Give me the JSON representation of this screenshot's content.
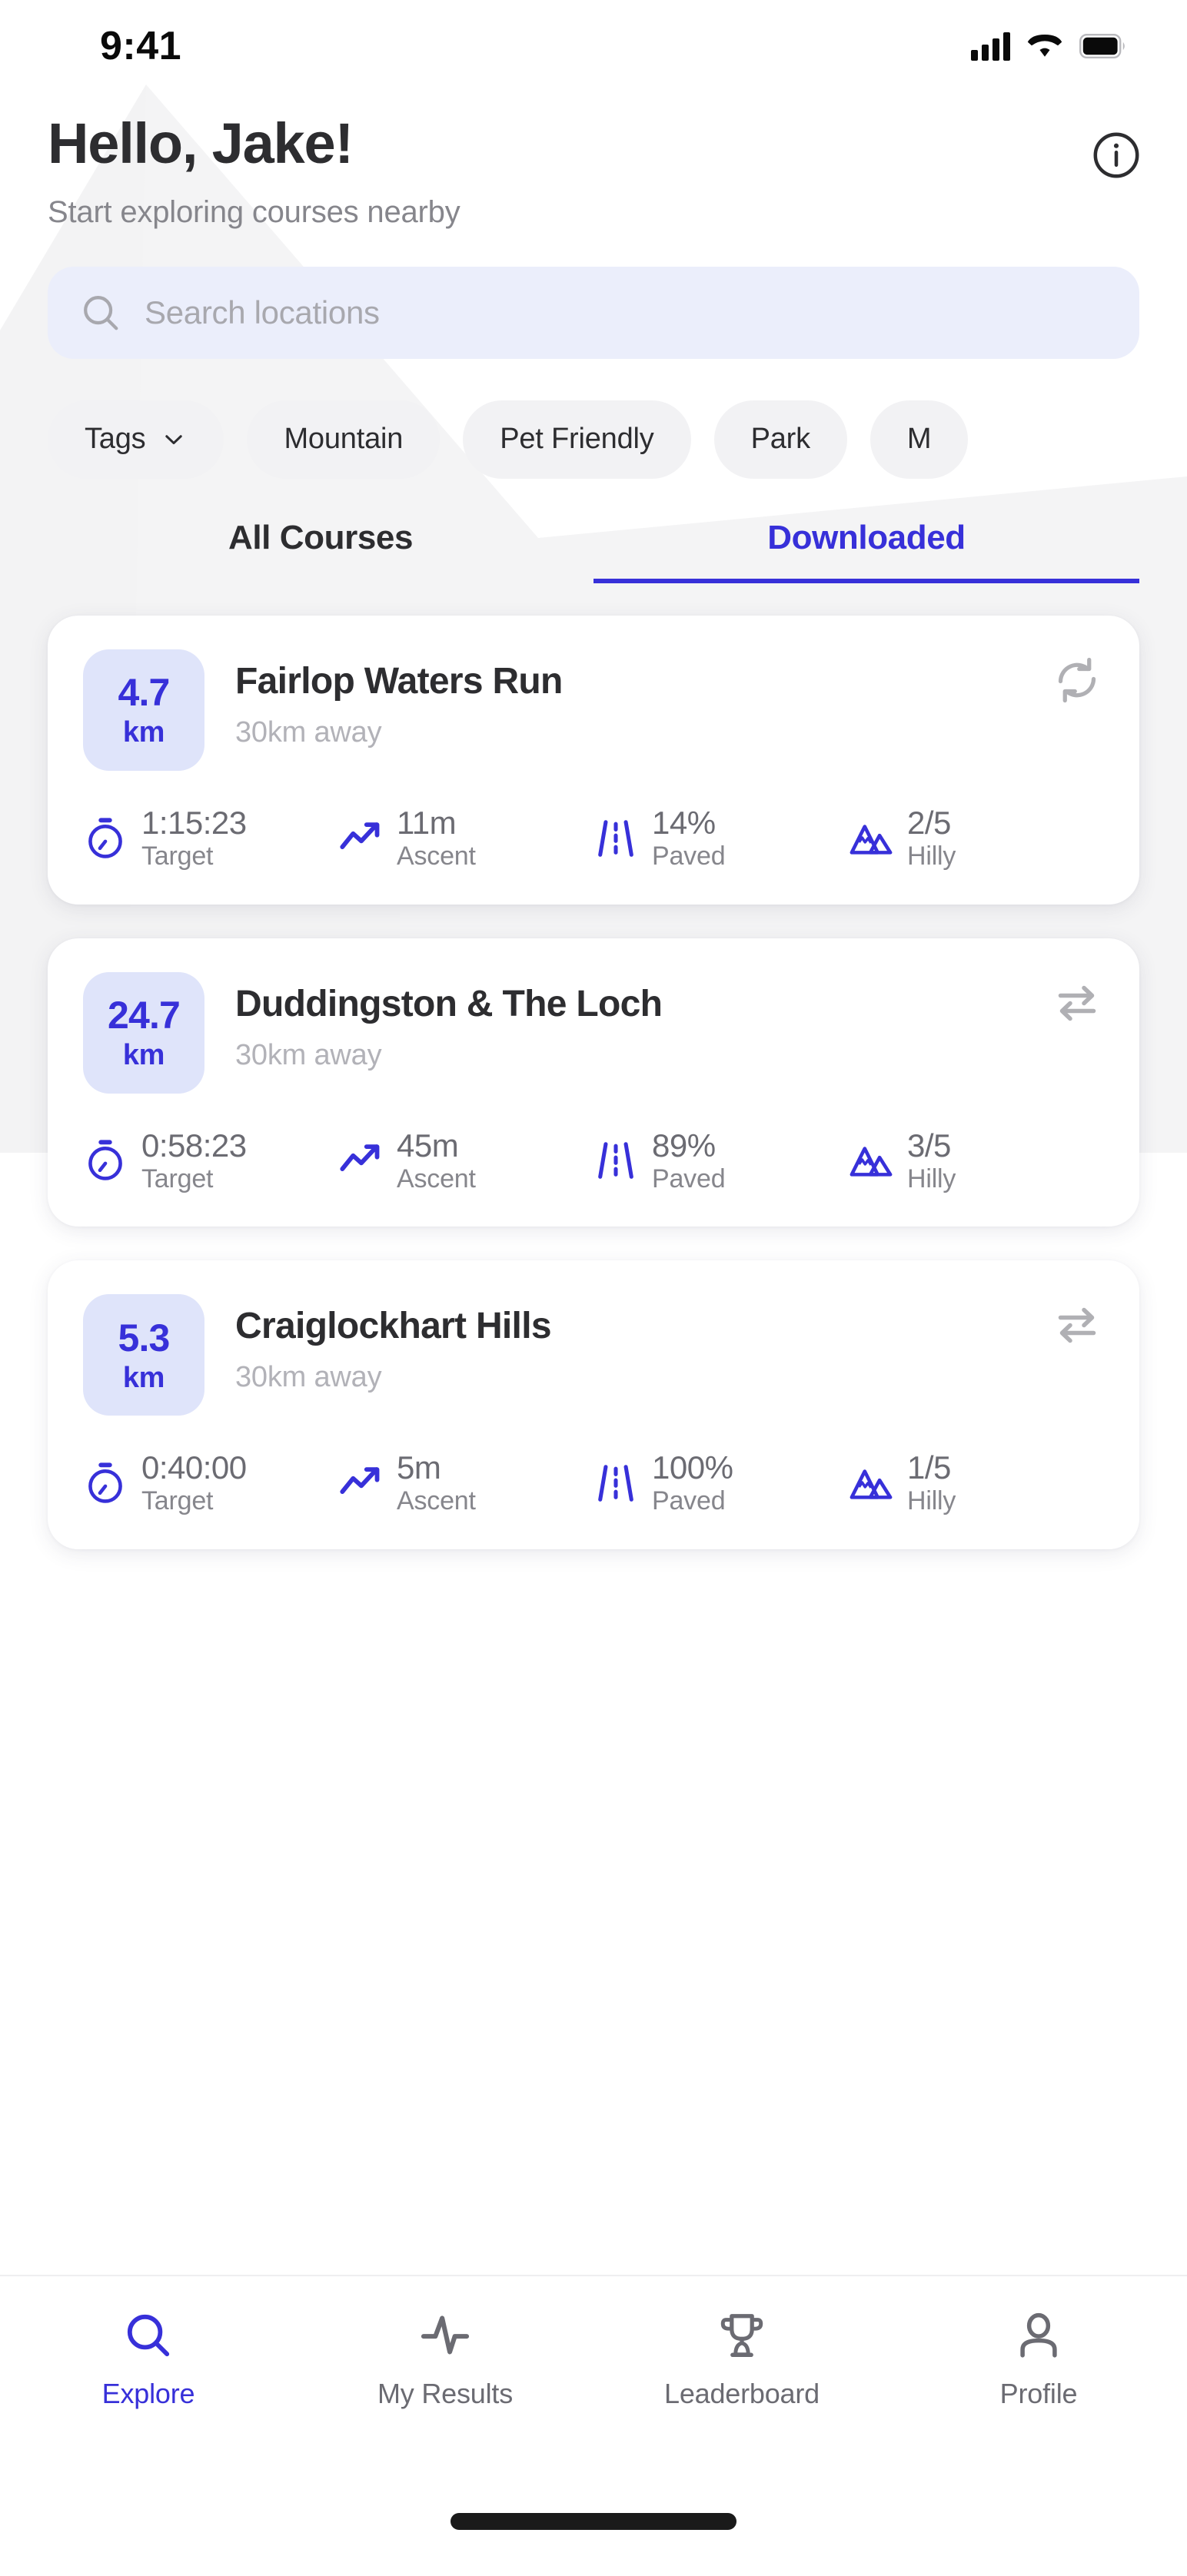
{
  "status_bar": {
    "time": "9:41",
    "cellular_icon": "signal-bars-icon",
    "wifi_icon": "wifi-icon",
    "battery_icon": "battery-icon"
  },
  "header": {
    "greeting": "Hello, Jake!",
    "subtitle": "Start exploring courses nearby",
    "info_icon": "info-circle-icon"
  },
  "search": {
    "placeholder": "Search locations",
    "icon": "search-icon",
    "value": ""
  },
  "filters": {
    "chips": [
      {
        "label": "Tags",
        "has_chevron": true
      },
      {
        "label": "Mountain",
        "has_chevron": false
      },
      {
        "label": "Pet Friendly",
        "has_chevron": false
      },
      {
        "label": "Park",
        "has_chevron": false
      },
      {
        "label": "M",
        "has_chevron": false
      }
    ]
  },
  "tabs": [
    {
      "label": "All Courses",
      "active": false
    },
    {
      "label": "Downloaded",
      "active": true
    }
  ],
  "courses": [
    {
      "distance_value": "4.7",
      "distance_unit": "km",
      "title": "Fairlop Waters Run",
      "subtitle": "30km away",
      "action_icon": "refresh-sync-icon",
      "stats": [
        {
          "icon": "stopwatch-icon",
          "value": "1:15:23",
          "label": "Target"
        },
        {
          "icon": "trending-up-icon",
          "value": "11m",
          "label": "Ascent"
        },
        {
          "icon": "road-icon",
          "value": "14%",
          "label": "Paved"
        },
        {
          "icon": "mountains-icon",
          "value": "2/5",
          "label": "Hilly"
        }
      ]
    },
    {
      "distance_value": "24.7",
      "distance_unit": "km",
      "title": "Duddingston & The Loch",
      "subtitle": "30km away",
      "action_icon": "swap-arrows-icon",
      "stats": [
        {
          "icon": "stopwatch-icon",
          "value": "0:58:23",
          "label": "Target"
        },
        {
          "icon": "trending-up-icon",
          "value": "45m",
          "label": "Ascent"
        },
        {
          "icon": "road-icon",
          "value": "89%",
          "label": "Paved"
        },
        {
          "icon": "mountains-icon",
          "value": "3/5",
          "label": "Hilly"
        }
      ]
    },
    {
      "distance_value": "5.3",
      "distance_unit": "km",
      "title": "Craiglockhart Hills",
      "subtitle": "30km away",
      "action_icon": "swap-arrows-icon",
      "stats": [
        {
          "icon": "stopwatch-icon",
          "value": "0:40:00",
          "label": "Target"
        },
        {
          "icon": "trending-up-icon",
          "value": "5m",
          "label": "Ascent"
        },
        {
          "icon": "road-icon",
          "value": "100%",
          "label": "Paved"
        },
        {
          "icon": "mountains-icon",
          "value": "1/5",
          "label": "Hilly"
        }
      ]
    }
  ],
  "bottom_nav": [
    {
      "label": "Explore",
      "icon": "search-icon",
      "active": true
    },
    {
      "label": "My Results",
      "icon": "activity-pulse-icon",
      "active": false
    },
    {
      "label": "Leaderboard",
      "icon": "trophy-icon",
      "active": false
    },
    {
      "label": "Profile",
      "icon": "person-icon",
      "active": false
    }
  ],
  "colors": {
    "accent": "#3730d9",
    "badge_bg": "#dfe4fa",
    "search_bg": "#ebeefb",
    "chip_bg": "#f2f2f4",
    "text_dark": "#2d2d30",
    "text_muted": "#86868c",
    "text_light": "#b2b2b8",
    "watermark": "#f4f4f5"
  }
}
